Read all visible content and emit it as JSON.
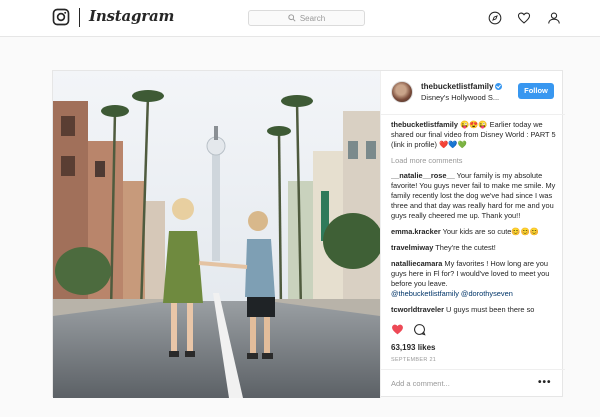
{
  "nav": {
    "wordmark": "Instagram",
    "search_placeholder": "Search",
    "icons": [
      "instagram-camera-icon",
      "compass-icon",
      "heart-icon",
      "profile-icon"
    ]
  },
  "post": {
    "username": "thebucketlistfamily",
    "location": "Disney's Hollywood S...",
    "follow_label": "Follow",
    "caption": {
      "username": "thebucketlistfamily",
      "text": " 😜😍😜 Earlier today we shared our final video from Disney World : PART 5 (link in profile) ❤️💙💚"
    },
    "load_more": "Load more comments",
    "comments": [
      {
        "username": "__natalie__rose__",
        "text": " Your family is my absolute favorite! You guys never fail to make me smile. My family recently lost the dog we've had since I was three and that day was really hard for me and you guys really cheered me up. Thank you!!"
      },
      {
        "username": "emma.kracker",
        "text": " Your kids are so cute😊😊😊"
      },
      {
        "username": "travelmiway",
        "text": " They're the cutest!"
      },
      {
        "username": "natalliecamara",
        "text": " My favorites ! How long are you guys here in Fl for? I would've loved to meet you before you leave.",
        "mentions": "@thebucketlistfamily @dorothyseven"
      },
      {
        "username": "tcworldtraveler",
        "text": " U guys must been there so"
      }
    ],
    "likes": "63,193 likes",
    "date": "SEPTEMBER 21",
    "add_comment_placeholder": "Add a comment...",
    "more_label": "•••"
  },
  "colors": {
    "accent": "#3897f0",
    "like_red": "#ed4956",
    "text": "#262626",
    "muted": "#999999",
    "border": "#e6e6e6"
  }
}
